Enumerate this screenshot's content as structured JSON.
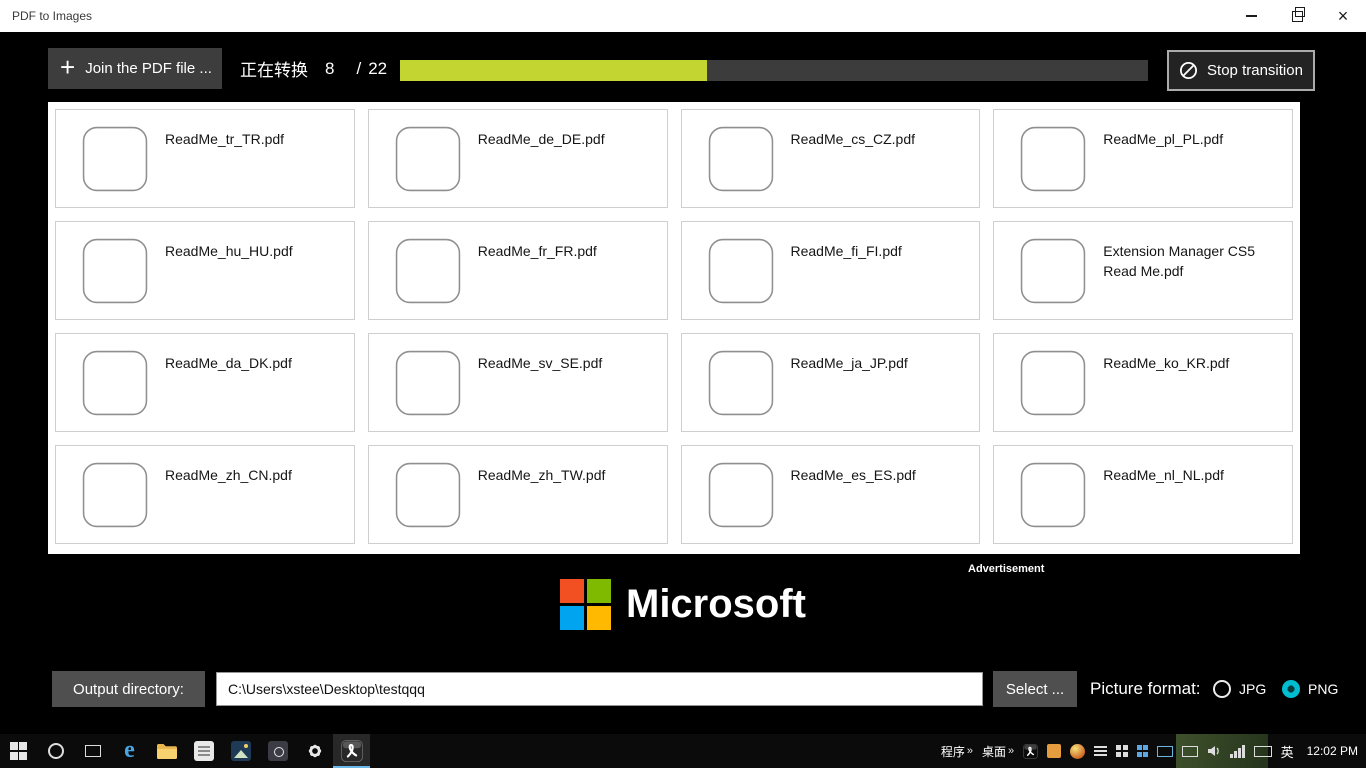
{
  "window": {
    "title": "PDF to Images",
    "close_icon": "×"
  },
  "toolbar": {
    "join_button": {
      "plus_icon": "+",
      "label": "Join the PDF file ..."
    },
    "progress": {
      "label": "正在转换",
      "current": "8",
      "separator": "/",
      "total": "22",
      "percent": 41,
      "fill_color": "#c3d531",
      "track_color": "#3c3c3c"
    },
    "stop_button": {
      "label": "Stop transition"
    }
  },
  "files": {
    "items": [
      {
        "name": "ReadMe_tr_TR.pdf"
      },
      {
        "name": "ReadMe_de_DE.pdf"
      },
      {
        "name": "ReadMe_cs_CZ.pdf"
      },
      {
        "name": "ReadMe_pl_PL.pdf"
      },
      {
        "name": "ReadMe_hu_HU.pdf"
      },
      {
        "name": "ReadMe_fr_FR.pdf"
      },
      {
        "name": "ReadMe_fi_FI.pdf"
      },
      {
        "name": "Extension Manager CS5 Read Me.pdf"
      },
      {
        "name": "ReadMe_da_DK.pdf"
      },
      {
        "name": "ReadMe_sv_SE.pdf"
      },
      {
        "name": "ReadMe_ja_JP.pdf"
      },
      {
        "name": "ReadMe_ko_KR.pdf"
      },
      {
        "name": "ReadMe_zh_CN.pdf"
      },
      {
        "name": "ReadMe_zh_TW.pdf"
      },
      {
        "name": "ReadMe_es_ES.pdf"
      },
      {
        "name": "ReadMe_nl_NL.pdf"
      }
    ]
  },
  "ad": {
    "label": "Advertisement",
    "brand": "Microsoft",
    "logo_colors": [
      "#f25022",
      "#7fba00",
      "#00a4ef",
      "#ffb900"
    ]
  },
  "output": {
    "directory_label": "Output directory:",
    "path_value": "C:\\Users\\xstee\\Desktop\\testqqq",
    "select_label": "Select ...",
    "format_label": "Picture format:",
    "formats": [
      {
        "label": "JPG",
        "selected": false
      },
      {
        "label": "PNG",
        "selected": true
      }
    ]
  },
  "taskbar": {
    "tray_toolbars": [
      {
        "label": "程序"
      },
      {
        "label": "桌面"
      }
    ],
    "chevron": "»",
    "ime_label": "英",
    "clock": "12:02 PM"
  }
}
